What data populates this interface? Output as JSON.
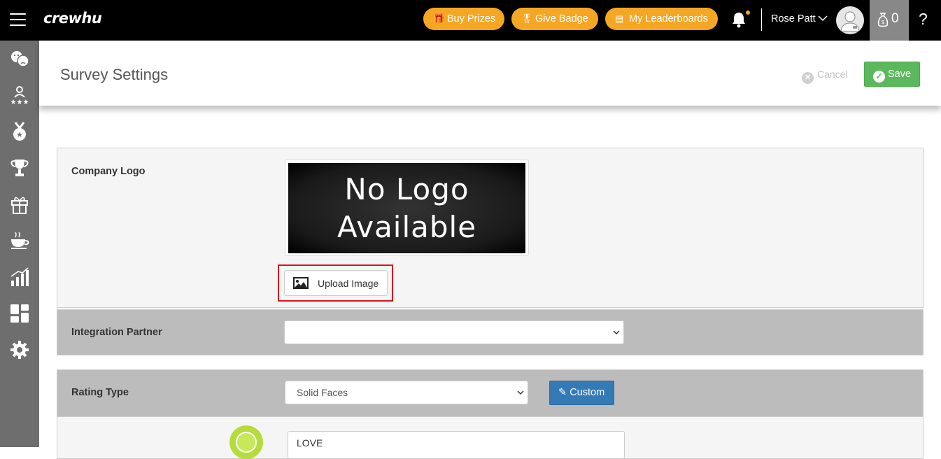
{
  "topbar": {
    "brand": "crewhu",
    "buttons": [
      {
        "label": "Buy Prizes",
        "icon": "gift-icon"
      },
      {
        "label": "Give Badge",
        "icon": "medal-icon"
      },
      {
        "label": "My Leaderboards",
        "icon": "podium-icon"
      }
    ],
    "username": "Rose Patt",
    "points": "0",
    "help": "?"
  },
  "sidebar": {
    "items": [
      {
        "name": "surveys-icon"
      },
      {
        "name": "team-icon"
      },
      {
        "name": "badges-icon"
      },
      {
        "name": "trophy-icon"
      },
      {
        "name": "prizes-icon"
      },
      {
        "name": "coffee-icon"
      },
      {
        "name": "reports-icon"
      },
      {
        "name": "dashboard-icon"
      },
      {
        "name": "settings-icon"
      }
    ]
  },
  "header": {
    "title": "Survey Settings",
    "cancel_label": "Cancel",
    "save_label": "Save"
  },
  "form": {
    "company_logo_label": "Company Logo",
    "logo_placeholder_line1": "No Logo",
    "logo_placeholder_line2": "Available",
    "upload_label": "Upload Image",
    "integration_label": "Integration Partner",
    "integration_value": "",
    "rating_type_label": "Rating Type",
    "rating_type_value": "Solid Faces",
    "custom_label": "Custom",
    "face_text_value": "LOVE"
  },
  "colors": {
    "accent_orange": "#f5a623",
    "save_green": "#5cb85c",
    "custom_blue": "#337ab7",
    "highlight_red": "#d9141d"
  }
}
